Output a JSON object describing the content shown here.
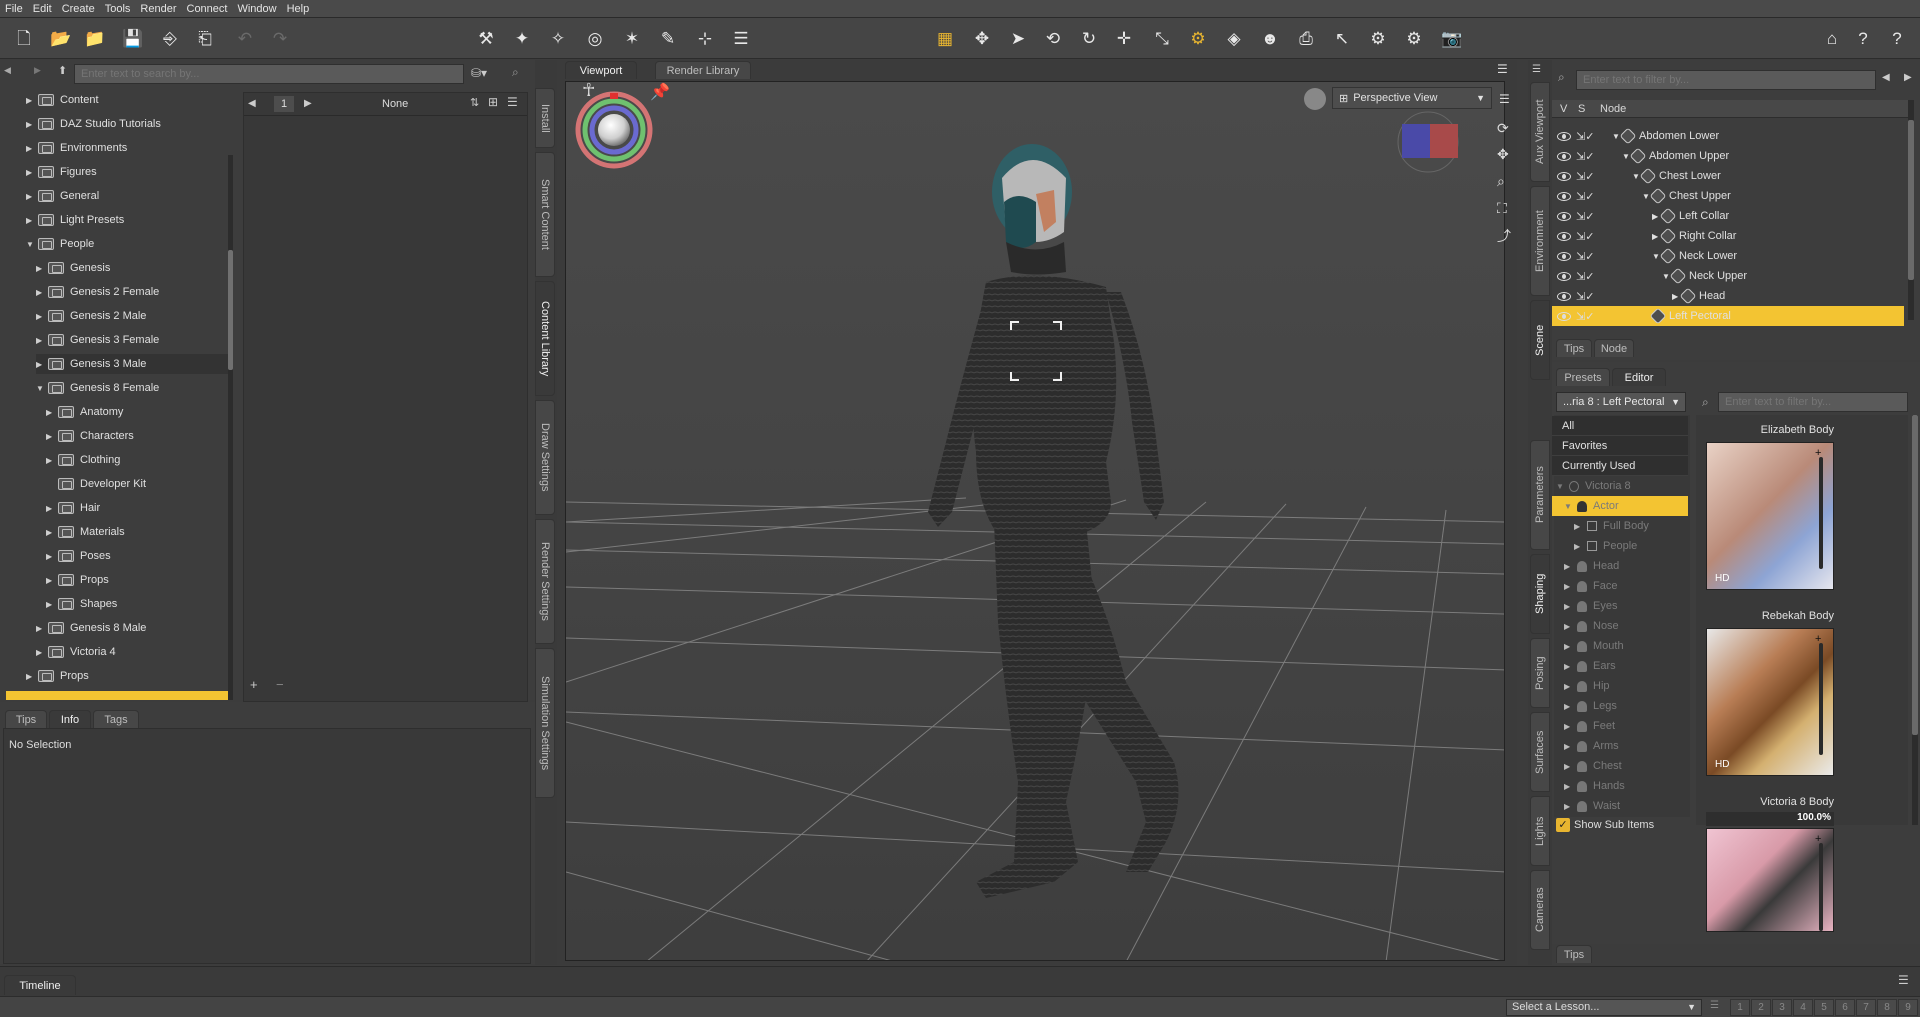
{
  "menu": [
    "File",
    "Edit",
    "Create",
    "Tools",
    "Render",
    "Connect",
    "Window",
    "Help"
  ],
  "left": {
    "search_placeholder": "Enter text to search by...",
    "tree": [
      {
        "label": "Content",
        "depth": 0,
        "arrow": "▶"
      },
      {
        "label": "DAZ Studio Tutorials",
        "depth": 0,
        "arrow": "▶"
      },
      {
        "label": "Environments",
        "depth": 0,
        "arrow": "▶"
      },
      {
        "label": "Figures",
        "depth": 0,
        "arrow": "▶"
      },
      {
        "label": "General",
        "depth": 0,
        "arrow": "▶"
      },
      {
        "label": "Light Presets",
        "depth": 0,
        "arrow": "▶"
      },
      {
        "label": "People",
        "depth": 0,
        "arrow": "▼"
      },
      {
        "label": "Genesis",
        "depth": 1,
        "arrow": "▶"
      },
      {
        "label": "Genesis 2 Female",
        "depth": 1,
        "arrow": "▶"
      },
      {
        "label": "Genesis 2 Male",
        "depth": 1,
        "arrow": "▶"
      },
      {
        "label": "Genesis 3 Female",
        "depth": 1,
        "arrow": "▶"
      },
      {
        "label": "Genesis 3 Male",
        "depth": 1,
        "arrow": "▶"
      },
      {
        "label": "Genesis 8 Female",
        "depth": 1,
        "arrow": "▼"
      },
      {
        "label": "Anatomy",
        "depth": 2,
        "arrow": "▶"
      },
      {
        "label": "Characters",
        "depth": 2,
        "arrow": "▶"
      },
      {
        "label": "Clothing",
        "depth": 2,
        "arrow": "▶"
      },
      {
        "label": "Developer Kit",
        "depth": 2,
        "arrow": ""
      },
      {
        "label": "Hair",
        "depth": 2,
        "arrow": "▶"
      },
      {
        "label": "Materials",
        "depth": 2,
        "arrow": "▶"
      },
      {
        "label": "Poses",
        "depth": 2,
        "arrow": "▶"
      },
      {
        "label": "Props",
        "depth": 2,
        "arrow": "▶"
      },
      {
        "label": "Shapes",
        "depth": 2,
        "arrow": "▶"
      },
      {
        "label": "Genesis 8 Male",
        "depth": 1,
        "arrow": "▶"
      },
      {
        "label": "Victoria 4",
        "depth": 1,
        "arrow": "▶"
      },
      {
        "label": "Props",
        "depth": 0,
        "arrow": "▶"
      }
    ],
    "page_number": "1",
    "page_filter": "None",
    "info_tabs": [
      "Tips",
      "Info",
      "Tags"
    ],
    "no_selection": "No Selection"
  },
  "side_tabs": [
    "Install",
    "Smart Content",
    "Content Library",
    "Draw Settings",
    "Render Settings",
    "Simulation Settings"
  ],
  "viewport": {
    "tabs": [
      "Viewport",
      "Render Library"
    ],
    "view": "Perspective View"
  },
  "scene": {
    "filter_placeholder": "Enter text to filter by...",
    "col_v": "V",
    "col_s": "S",
    "col_node": "Node",
    "nodes": [
      {
        "label": "Abdomen Lower",
        "depth": 0,
        "arrow": "▼"
      },
      {
        "label": "Abdomen Upper",
        "depth": 1,
        "arrow": "▼"
      },
      {
        "label": "Chest Lower",
        "depth": 2,
        "arrow": "▼"
      },
      {
        "label": "Chest Upper",
        "depth": 3,
        "arrow": "▼"
      },
      {
        "label": "Left Collar",
        "depth": 4,
        "arrow": "▶"
      },
      {
        "label": "Right Collar",
        "depth": 4,
        "arrow": "▶"
      },
      {
        "label": "Neck Lower",
        "depth": 4,
        "arrow": "▼"
      },
      {
        "label": "Neck Upper",
        "depth": 5,
        "arrow": "▼"
      },
      {
        "label": "Head",
        "depth": 6,
        "arrow": "▶"
      },
      {
        "label": "Left Pectoral",
        "depth": 3,
        "arrow": ""
      }
    ],
    "tabs": [
      "Tips",
      "Node"
    ]
  },
  "right_tabs": [
    "Aux Viewport",
    "Environment",
    "Scene"
  ],
  "right_tabs2": [
    "Parameters",
    "Shaping",
    "Posing",
    "Surfaces",
    "Lights",
    "Cameras"
  ],
  "shaping": {
    "tabs": [
      "Presets",
      "Editor"
    ],
    "dropdown": "...ria 8 : Left Pectoral",
    "filter_placeholder": "Enter text to filter by...",
    "lists": [
      "All",
      "Favorites",
      "Currently Used"
    ],
    "figure": "Victoria 8",
    "actor": "Actor",
    "groups": [
      "Full Body",
      "People"
    ],
    "parts": [
      "Head",
      "Face",
      "Eyes",
      "Nose",
      "Mouth",
      "Ears",
      "Hip",
      "Legs",
      "Feet",
      "Arms",
      "Chest",
      "Hands",
      "Waist"
    ],
    "show_sub": "Show Sub Items",
    "thumbs": [
      {
        "name": "Elizabeth Body"
      },
      {
        "name": "Rebekah Body"
      },
      {
        "name": "Victoria 8 Body",
        "value": "100.0%"
      }
    ],
    "hd": "HD",
    "tips": "Tips"
  },
  "timeline": "Timeline",
  "lesson": "Select a Lesson...",
  "lesson_steps": [
    "1",
    "2",
    "3",
    "4",
    "5",
    "6",
    "7",
    "8",
    "9"
  ]
}
